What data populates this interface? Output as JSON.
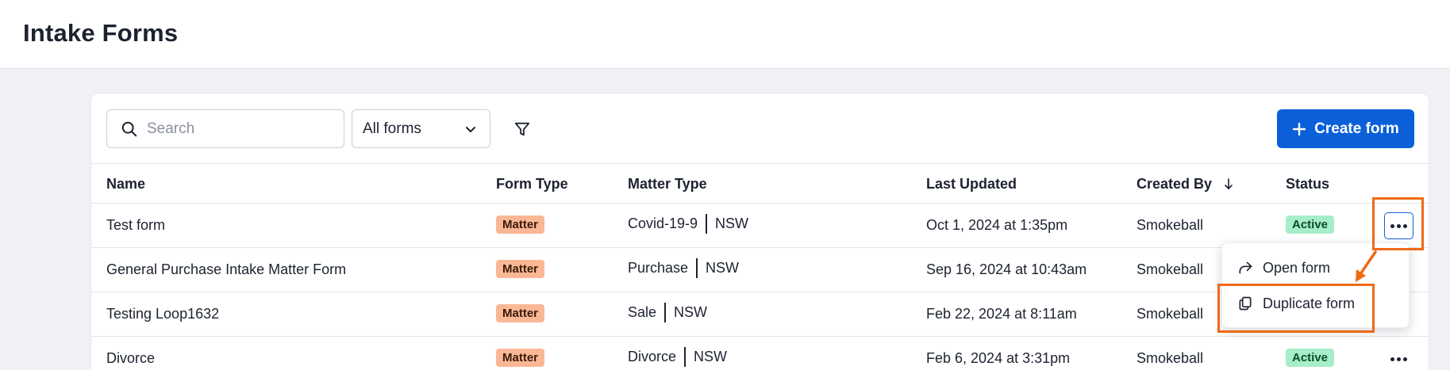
{
  "page": {
    "title": "Intake Forms"
  },
  "toolbar": {
    "search_placeholder": "Search",
    "filter_select_value": "All forms",
    "create_button_label": "Create form"
  },
  "table": {
    "headers": {
      "name": "Name",
      "form_type": "Form Type",
      "matter_type": "Matter Type",
      "last_updated": "Last Updated",
      "created_by": "Created By",
      "status": "Status"
    },
    "rows": [
      {
        "name": "Test form",
        "form_type": "Matter",
        "matter_type": "Covid-19-9",
        "state": "NSW",
        "last_updated": "Oct 1, 2024 at 1:35pm",
        "created_by": "Smokeball",
        "status": "Active"
      },
      {
        "name": "General Purchase Intake Matter Form",
        "form_type": "Matter",
        "matter_type": "Purchase",
        "state": "NSW",
        "last_updated": "Sep 16, 2024 at 10:43am",
        "created_by": "Smokeball",
        "status": ""
      },
      {
        "name": "Testing Loop1632",
        "form_type": "Matter",
        "matter_type": "Sale",
        "state": "NSW",
        "last_updated": "Feb 22, 2024 at 8:11am",
        "created_by": "Smokeball",
        "status": ""
      },
      {
        "name": "Divorce",
        "form_type": "Matter",
        "matter_type": "Divorce",
        "state": "NSW",
        "last_updated": "Feb 6, 2024 at 3:31pm",
        "created_by": "Smokeball",
        "status": "Active"
      }
    ]
  },
  "context_menu": {
    "open_label": "Open form",
    "duplicate_label": "Duplicate form"
  },
  "colors": {
    "accent": "#0b5fd9",
    "annotation": "#ee6a16",
    "matter_badge": "#f9b796",
    "active_badge": "#a6eec8"
  }
}
